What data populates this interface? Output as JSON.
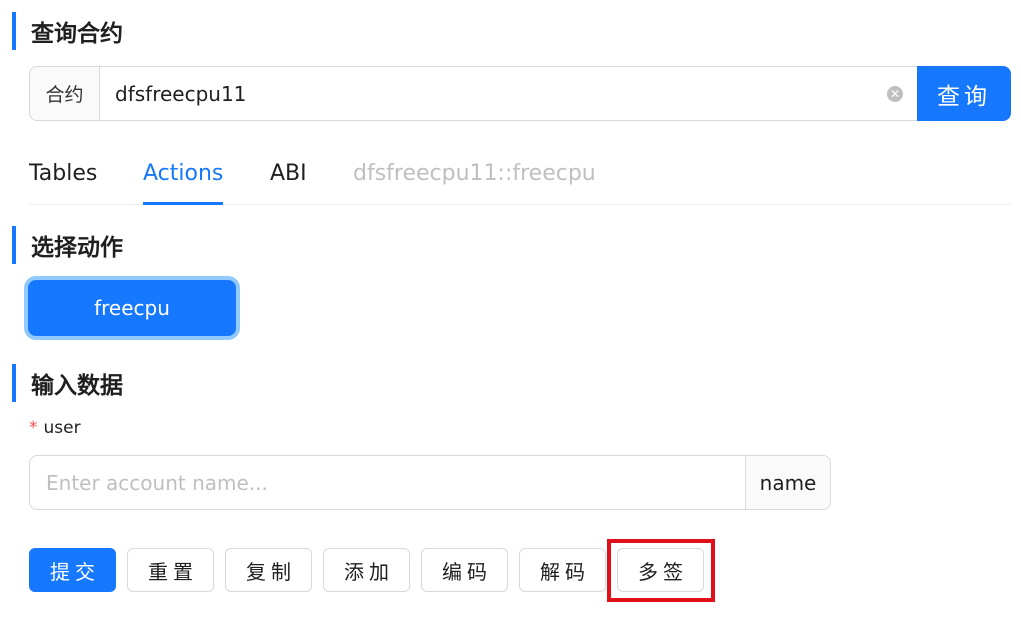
{
  "query_section": {
    "title": "查询合约",
    "addon_label": "合约",
    "input_value": "dfsfreecpu11",
    "query_button": "查询"
  },
  "tabs": [
    {
      "label": "Tables",
      "state": "normal"
    },
    {
      "label": "Actions",
      "state": "active"
    },
    {
      "label": "ABI",
      "state": "normal"
    },
    {
      "label": "dfsfreecpu11::freecpu",
      "state": "disabled"
    }
  ],
  "action_section": {
    "title": "选择动作",
    "actions": [
      "freecpu"
    ]
  },
  "input_section": {
    "title": "输入数据",
    "required_mark": "*",
    "field_label": "user",
    "placeholder": "Enter account name...",
    "addon": "name"
  },
  "buttons": {
    "submit": "提交",
    "reset": "重置",
    "copy": "复制",
    "add": "添加",
    "encode": "编码",
    "decode": "解码",
    "multisig": "多签"
  },
  "colors": {
    "accent": "#1677ff",
    "highlight": "#e0101a"
  }
}
